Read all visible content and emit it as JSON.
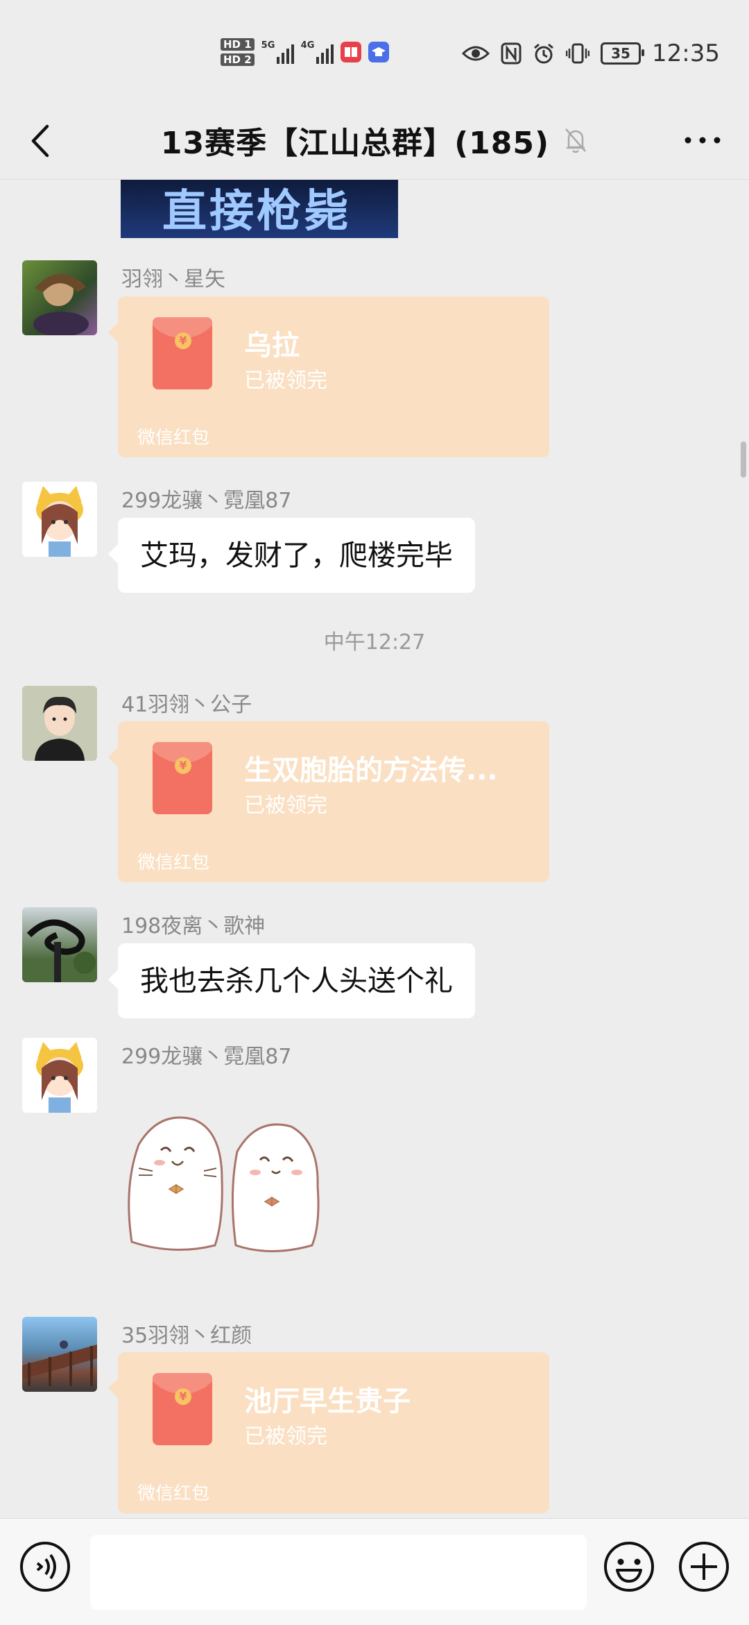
{
  "status_bar": {
    "hd1": "HD 1",
    "hd2": "HD 2",
    "signal1": "5G",
    "signal2": "4G",
    "battery": "35",
    "time": "12:35"
  },
  "header": {
    "title": "13赛季【江山总群】(185)"
  },
  "previous_image_text": "直接枪毙",
  "messages": [
    {
      "sender": "羽翎丶星矢",
      "type": "red_packet",
      "title": "乌拉",
      "status": "已被领完",
      "footer": "微信红包"
    },
    {
      "sender": "299龙骧丶霓凰87",
      "type": "text",
      "text": "艾玛，发财了，爬楼完毕"
    },
    {
      "timestamp": "中午12:27"
    },
    {
      "sender": "41羽翎丶公子",
      "type": "red_packet",
      "title": "生双胞胎的方法传...",
      "status": "已被领完",
      "footer": "微信红包"
    },
    {
      "sender": "198夜离丶歌神",
      "type": "text",
      "text": "我也去杀几个人头送个礼"
    },
    {
      "sender": "299龙骧丶霓凰87",
      "type": "sticker",
      "sticker": "two-seals-sticker"
    },
    {
      "sender": "35羽翎丶红颜",
      "type": "red_packet",
      "title": "池厅早生贵子",
      "status": "已被领完",
      "footer": "微信红包"
    }
  ],
  "input_bar": {
    "placeholder": ""
  },
  "colors": {
    "background": "#ededed",
    "red_packet": "#fadfc2",
    "envelope": "#f27162"
  }
}
